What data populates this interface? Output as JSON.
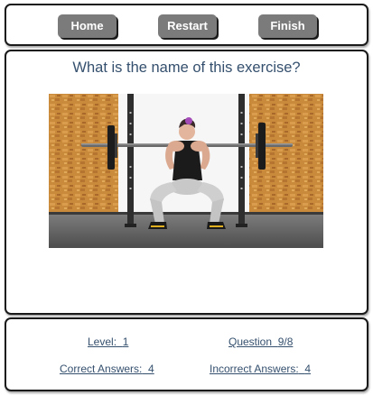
{
  "nav": {
    "home_label": "Home",
    "restart_label": "Restart",
    "finish_label": "Finish"
  },
  "question": {
    "prompt": "What is the name of this exercise?",
    "image_subject": "person performing barbell back squat in a squat rack"
  },
  "stats": {
    "level_label": "Level:",
    "level_value": "1",
    "question_label": "Question",
    "question_value": "9/8",
    "correct_label": "Correct Answers:",
    "correct_value": "4",
    "incorrect_label": "Incorrect Answers:",
    "incorrect_value": "4"
  },
  "colors": {
    "button_bg": "#7b7b7b",
    "button_text": "#ffffff",
    "title_text": "#35506e",
    "link_text": "#35506e",
    "panel_border": "#1a1a1a"
  }
}
